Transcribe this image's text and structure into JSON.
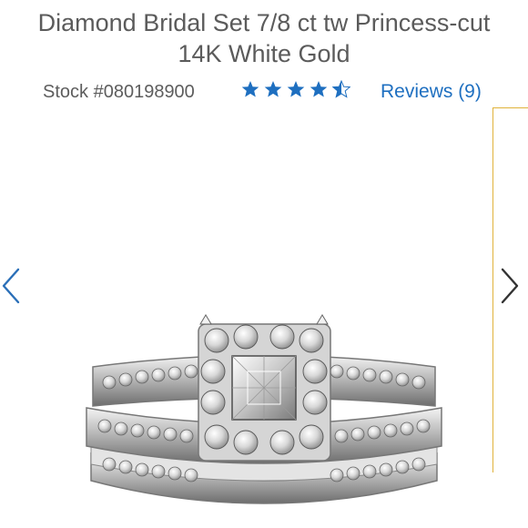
{
  "product": {
    "title_line1": "Diamond Bridal Set 7/8 ct tw Princess-cut",
    "title_line2": "14K White Gold",
    "stock": "Stock #080198900",
    "rating": 4.5,
    "rating_max": 5,
    "reviews_label": "Reviews (9)"
  },
  "colors": {
    "star": "#1e6fc0",
    "link": "#1e6fc0",
    "accent_border": "#e0b23a",
    "arrow": "#2a6fb8"
  },
  "gallery": {
    "prev_icon": "chevron-left-icon",
    "next_icon": "chevron-right-icon"
  }
}
